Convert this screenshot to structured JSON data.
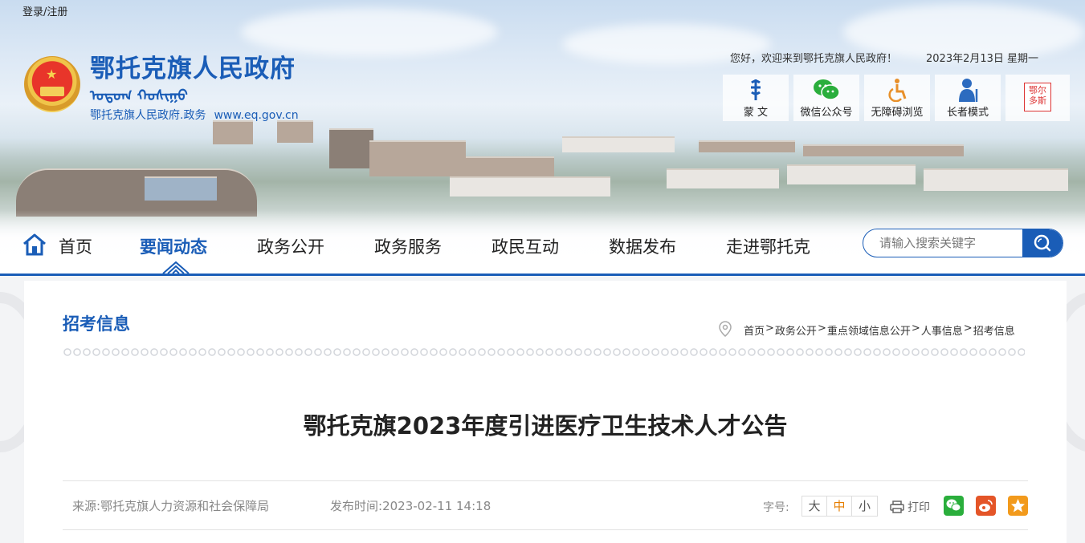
{
  "header": {
    "login": "登录/注册",
    "site_title": "鄂托克旗人民政府",
    "mongolian_script": "ᠣᠲᠣᠭ ᠬᠣᠰᠢᠭᠤ",
    "sub_name": "鄂托克旗人民政府.政务",
    "url": "www.eq.gov.cn",
    "welcome": "您好，欢迎来到鄂托克旗人民政府！",
    "date": "2023年2月13日 星期一",
    "tools": [
      {
        "label": "蒙  文",
        "icon": "mongolian-script-icon"
      },
      {
        "label": "微信公众号",
        "icon": "wechat-icon"
      },
      {
        "label": "无障碍浏览",
        "icon": "accessibility-icon"
      },
      {
        "label": "长者模式",
        "icon": "elder-mode-icon"
      }
    ],
    "seal_text": "鄂尔多斯",
    "accent_color": "#1a5db7"
  },
  "nav": {
    "items": [
      "首页",
      "要闻动态",
      "政务公开",
      "政务服务",
      "政民互动",
      "数据发布",
      "走进鄂托克"
    ],
    "active_index": 1,
    "search_placeholder": "请输入搜索关键字"
  },
  "content": {
    "section_title": "招考信息",
    "breadcrumb": [
      "首页",
      "政务公开",
      "重点领域信息公开",
      "人事信息",
      "招考信息"
    ],
    "breadcrumb_separator": ">",
    "article_title": "鄂托克旗2023年度引进医疗卫生技术人才公告",
    "source_label": "来源:",
    "source": "鄂托克旗人力资源和社会保障局",
    "publish_label": "发布时间:",
    "publish_time": "2023-02-11 14:18",
    "font_size_label": "字号:",
    "font_sizes": [
      "大",
      "中",
      "小"
    ],
    "font_size_selected": "中",
    "print_label": "打印",
    "share": [
      "wechat-icon",
      "weibo-icon",
      "favorite-icon"
    ]
  }
}
